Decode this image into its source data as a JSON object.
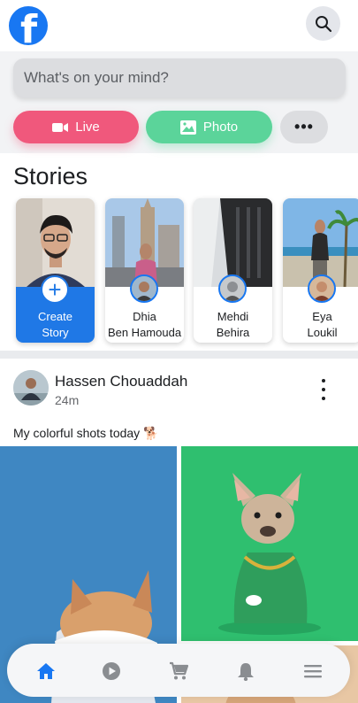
{
  "colors": {
    "brand_blue": "#1877f2",
    "live_pink": "#f0587c",
    "photo_green": "#5bd49a",
    "nav_active": "#1877f2",
    "nav_inactive": "#8a8d91"
  },
  "header": {
    "logo_letter": "f",
    "logo_icon": "facebook-logo-icon",
    "search_icon": "search-icon"
  },
  "composer": {
    "placeholder": "What's on your mind?",
    "value": ""
  },
  "actions": {
    "live_label": "Live",
    "live_icon": "video-camera-icon",
    "photo_label": "Photo",
    "photo_icon": "image-icon",
    "more_label": "•••",
    "more_icon": "more-dots-icon"
  },
  "stories": {
    "title": "Stories",
    "items": [
      {
        "line1": "Create",
        "line2": "Story",
        "icon": "plus-icon"
      },
      {
        "line1": "Dhia",
        "line2": "Ben Hamouda"
      },
      {
        "line1": "Mehdi",
        "line2": "Behira"
      },
      {
        "line1": "Eya",
        "line2": "Loukil"
      }
    ]
  },
  "post": {
    "author": "Hassen Chouaddah",
    "time": "24m",
    "caption": "My colorful shots today 🐕",
    "menu_icon": "more-vertical-icon"
  },
  "bottom_nav": {
    "items": [
      {
        "name": "home",
        "icon": "home-icon",
        "active": true
      },
      {
        "name": "watch",
        "icon": "play-circle-icon",
        "active": false
      },
      {
        "name": "marketplace",
        "icon": "cart-icon",
        "active": false
      },
      {
        "name": "notifications",
        "icon": "bell-icon",
        "active": false
      },
      {
        "name": "menu",
        "icon": "hamburger-menu-icon",
        "active": false
      }
    ]
  }
}
